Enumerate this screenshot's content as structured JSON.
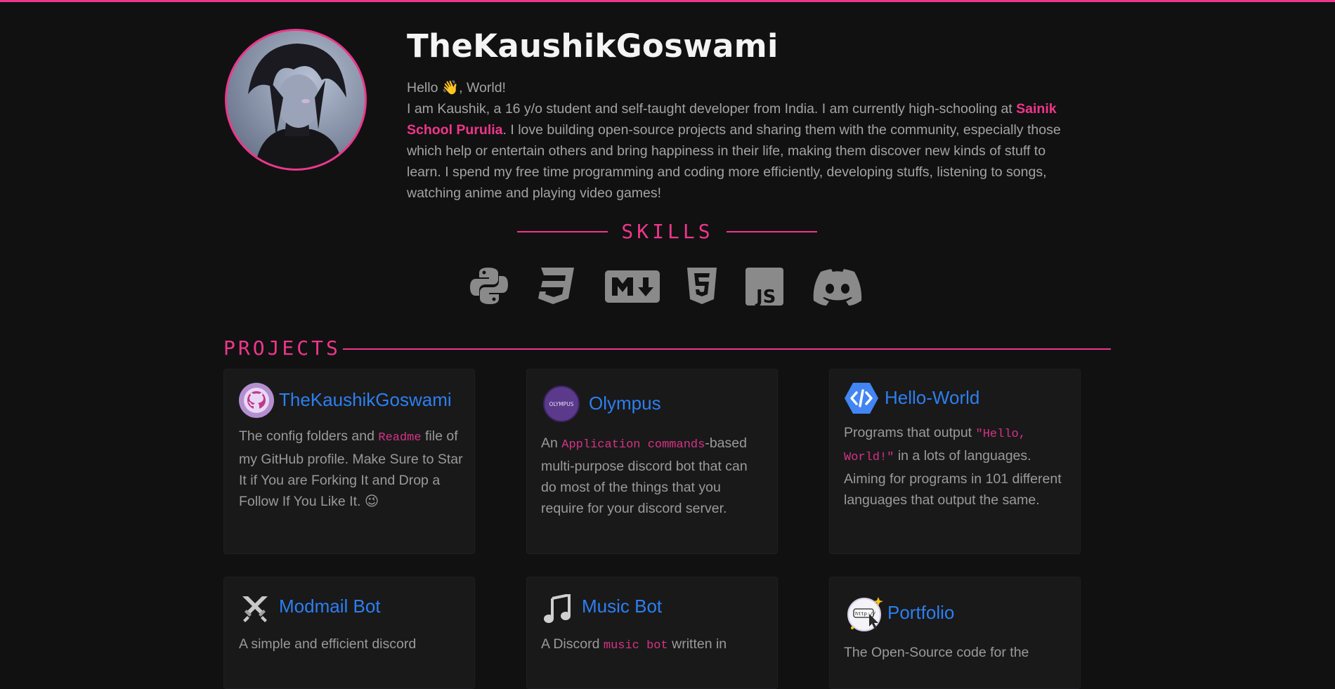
{
  "colors": {
    "accent": "#f0368a",
    "link": "#2d7ff0",
    "background": "#111112",
    "card": "#19191a"
  },
  "profile": {
    "name": "TheKaushikGoswami",
    "greeting": "Hello 👋, World!",
    "bio_part1": "I am Kaushik, a 16 y/o student and self-taught developer from India. I am currently high-schooling at ",
    "school": "Sainik School Purulia",
    "bio_part2": ". I love building open-source projects and sharing them with the community, especially those which help or entertain others and bring happiness in their life, making them discover new kinds of stuff to learn. I spend my free time programming and coding more efficiently, developing stuffs, listening to songs, watching anime and playing video games!"
  },
  "skills": {
    "heading": "SKILLS",
    "icons": [
      "python-icon",
      "css3-icon",
      "markdown-icon",
      "html5-icon",
      "javascript-icon",
      "discord-icon"
    ]
  },
  "projects": {
    "heading": "PROJECTS",
    "items": [
      {
        "title": "TheKaushikGoswami",
        "desc_a": "The config folders and ",
        "code": "Readme",
        "desc_b": " file of my GitHub profile. Make Sure to Star It if You are Forking It and Drop a Follow If You Like It. 😉"
      },
      {
        "title": "Olympus",
        "logo_text": "OLYMPUS",
        "desc_a": "An ",
        "code": "Application commands",
        "desc_b": "-based multi-purpose discord bot that can do most of the things that you require for your discord server."
      },
      {
        "title": "Hello-World",
        "desc_a": "Programs that output ",
        "code": "\"Hello, World!\"",
        "desc_b": " in a lots of languages. Aiming for programs in 101 different languages that output the same."
      },
      {
        "title": "Modmail Bot",
        "desc_a": "A simple and efficient discord",
        "code": "",
        "desc_b": ""
      },
      {
        "title": "Music Bot",
        "desc_a": "A Discord ",
        "code": "music bot",
        "desc_b": " written in"
      },
      {
        "title": "Portfolio",
        "logo_text": "http://",
        "desc_a": "The Open-Source code for the",
        "code": "",
        "desc_b": ""
      }
    ]
  }
}
